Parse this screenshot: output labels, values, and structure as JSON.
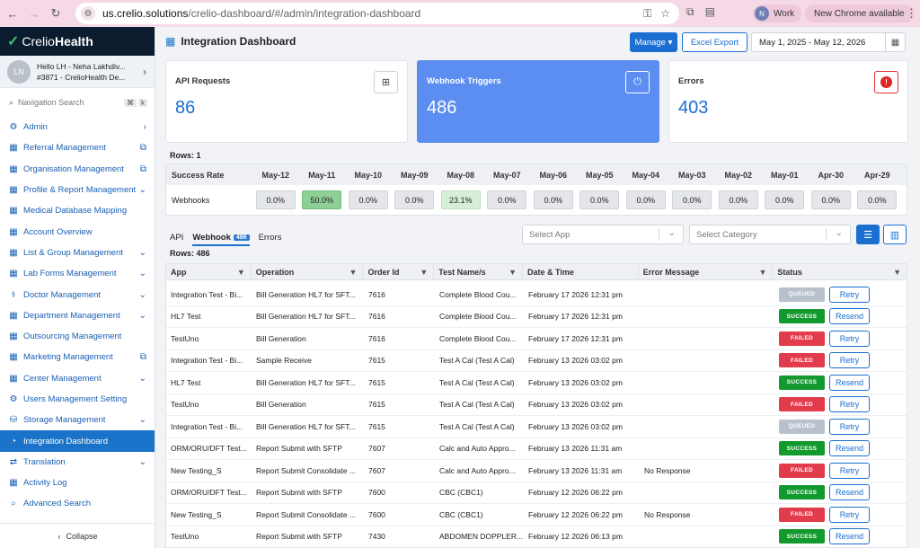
{
  "browser": {
    "url_host": "us.crelio.solutions",
    "url_path": "/crelio-dashboard/#/admin/integration-dashboard",
    "profile_initial": "N",
    "profile_name": "Work",
    "update_label": "New Chrome available"
  },
  "brand": {
    "name_a": "Crelio",
    "name_b": "Health"
  },
  "user": {
    "initials": "LN",
    "line1": "Hello LH - Neha Lakhdiv...",
    "line2": "#3871 - CrelioHealth De..."
  },
  "nav_search": {
    "placeholder": "Navigation Search",
    "key1": "⌘",
    "key2": "k"
  },
  "sidebar": {
    "items": [
      {
        "label": "Admin"
      },
      {
        "label": "Referral Management"
      },
      {
        "label": "Organisation Management"
      },
      {
        "label": "Profile & Report Management"
      },
      {
        "label": "Medical Database Mapping"
      },
      {
        "label": "Account Overview"
      },
      {
        "label": "List & Group Management"
      },
      {
        "label": "Lab Forms Management"
      },
      {
        "label": "Doctor Management"
      },
      {
        "label": "Department Management"
      },
      {
        "label": "Outsourcing Management"
      },
      {
        "label": "Marketing Management"
      },
      {
        "label": "Center Management"
      },
      {
        "label": "Users Management Setting"
      },
      {
        "label": "Storage Management"
      },
      {
        "label": "Integration Dashboard"
      },
      {
        "label": "Translation"
      },
      {
        "label": "Activity Log"
      },
      {
        "label": "Advanced Search"
      }
    ],
    "collapse_label": "Collapse"
  },
  "header": {
    "title": "Integration Dashboard",
    "manage_label": "Manage ▾",
    "excel_label": "Excel Export",
    "date_range": "May 1, 2025 - May 12, 2026"
  },
  "cards": {
    "api": {
      "label": "API Requests",
      "value": "86"
    },
    "webhook": {
      "label": "Webhook Triggers",
      "value": "486"
    },
    "errors": {
      "label": "Errors",
      "value": "403"
    }
  },
  "rate": {
    "rows_label": "Rows: 1",
    "header_first": "Success Rate",
    "dates": [
      "May-12",
      "May-11",
      "May-10",
      "May-09",
      "May-08",
      "May-07",
      "May-06",
      "May-05",
      "May-04",
      "May-03",
      "May-02",
      "May-01",
      "Apr-30",
      "Apr-29"
    ],
    "row_label": "Webhooks",
    "values": [
      "0.0%",
      "50.0%",
      "0.0%",
      "0.0%",
      "23.1%",
      "0.0%",
      "0.0%",
      "0.0%",
      "0.0%",
      "0.0%",
      "0.0%",
      "0.0%",
      "0.0%",
      "0.0%"
    ]
  },
  "tabs": {
    "api": "API",
    "webhook": "Webhook",
    "webhook_count": "486",
    "errors": "Errors"
  },
  "filters": {
    "app_placeholder": "Select App",
    "category_placeholder": "Select Category"
  },
  "list": {
    "rows_label": "Rows: 486",
    "columns": [
      "App",
      "Operation",
      "Order Id",
      "Test Name/s",
      "Date & Time",
      "Error Message",
      "Status"
    ],
    "rows": [
      {
        "app": "Integration Test - Bi...",
        "op": "Bill Generation HL7 for SFT...",
        "order": "7616",
        "test": "Complete Blood Cou...",
        "date": "February 17 2026 12:31 pm",
        "err": "",
        "status": "QUEUED",
        "action": "Retry"
      },
      {
        "app": "HL7 Test",
        "op": "Bill Generation HL7 for SFT...",
        "order": "7616",
        "test": "Complete Blood Cou...",
        "date": "February 17 2026 12:31 pm",
        "err": "",
        "status": "SUCCESS",
        "action": "Resend"
      },
      {
        "app": "TestUno",
        "op": "Bill Generation",
        "order": "7616",
        "test": "Complete Blood Cou...",
        "date": "February 17 2026 12:31 pm",
        "err": "",
        "status": "FAILED",
        "action": "Retry"
      },
      {
        "app": "Integration Test - Bi...",
        "op": "Sample Receive",
        "order": "7615",
        "test": "Test A Cal (Test A Cal)",
        "date": "February 13 2026 03:02 pm",
        "err": "",
        "status": "FAILED",
        "action": "Retry"
      },
      {
        "app": "HL7 Test",
        "op": "Bill Generation HL7 for SFT...",
        "order": "7615",
        "test": "Test A Cal (Test A Cal)",
        "date": "February 13 2026 03:02 pm",
        "err": "",
        "status": "SUCCESS",
        "action": "Resend"
      },
      {
        "app": "TestUno",
        "op": "Bill Generation",
        "order": "7615",
        "test": "Test A Cal (Test A Cal)",
        "date": "February 13 2026 03:02 pm",
        "err": "",
        "status": "FAILED",
        "action": "Retry"
      },
      {
        "app": "Integration Test - Bi...",
        "op": "Bill Generation HL7 for SFT...",
        "order": "7615",
        "test": "Test A Cal (Test A Cal)",
        "date": "February 13 2026 03:02 pm",
        "err": "",
        "status": "QUEUED",
        "action": "Retry"
      },
      {
        "app": "ORM/ORU/DFT Test...",
        "op": "Report Submit with SFTP",
        "order": "7607",
        "test": "Calc and Auto Appro...",
        "date": "February 13 2026 11:31 am",
        "err": "",
        "status": "SUCCESS",
        "action": "Resend"
      },
      {
        "app": "New Testing_S",
        "op": "Report Submit Consolidate ...",
        "order": "7607",
        "test": "Calc and Auto Appro...",
        "date": "February 13 2026 11:31 am",
        "err": "No Response",
        "status": "FAILED",
        "action": "Retry"
      },
      {
        "app": "ORM/ORU/DFT Test...",
        "op": "Report Submit with SFTP",
        "order": "7600",
        "test": "CBC (CBC1)",
        "date": "February 12 2026 06:22 pm",
        "err": "",
        "status": "SUCCESS",
        "action": "Resend"
      },
      {
        "app": "New Testing_S",
        "op": "Report Submit Consolidate ...",
        "order": "7600",
        "test": "CBC (CBC1)",
        "date": "February 12 2026 06:22 pm",
        "err": "No Response",
        "status": "FAILED",
        "action": "Retry"
      },
      {
        "app": "TestUno",
        "op": "Report Submit with SFTP",
        "order": "7430",
        "test": "ABDOMEN DOPPLER...",
        "date": "February 12 2026 06:13 pm",
        "err": "",
        "status": "SUCCESS",
        "action": "Resend"
      }
    ]
  }
}
